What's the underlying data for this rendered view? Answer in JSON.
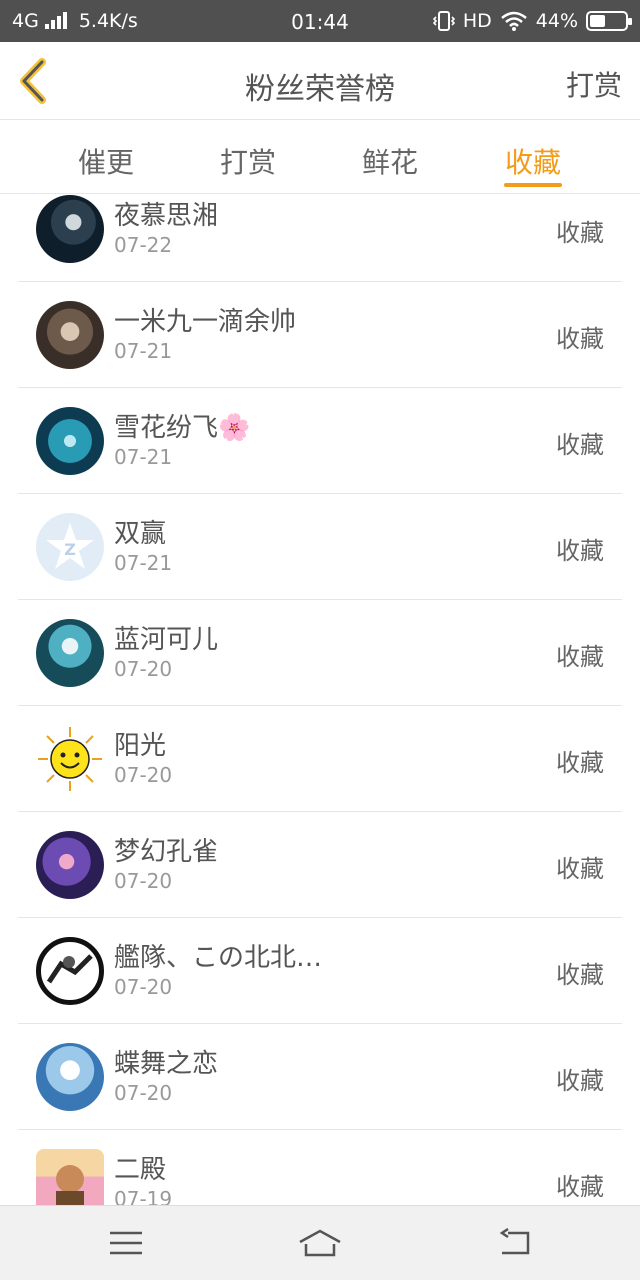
{
  "status_bar": {
    "network": "4G",
    "speed": "5.4K/s",
    "time": "01:44",
    "hd": "HD",
    "battery": "44%",
    "battery_level": 0.44
  },
  "header": {
    "back_icon": "chevron-left-icon",
    "title": "粉丝荣誉榜",
    "right_action": "打赏"
  },
  "tabs": [
    {
      "label": "催更"
    },
    {
      "label": "打赏"
    },
    {
      "label": "鲜花"
    },
    {
      "label": "收藏"
    }
  ],
  "active_tab": "收藏",
  "colors": {
    "accent": "#f39c19",
    "status_bar": "#505050",
    "text": "#555555",
    "subtext": "#999999",
    "divider": "#e6e6e6"
  },
  "list": [
    {
      "name": "夜慕思湘",
      "date": "07-22",
      "action": "收藏"
    },
    {
      "name": "一米九一滴余帅",
      "date": "07-21",
      "action": "收藏"
    },
    {
      "name": "雪花纷飞🌸",
      "date": "07-21",
      "action": "收藏"
    },
    {
      "name": "双赢",
      "date": "07-21",
      "action": "收藏"
    },
    {
      "name": "蓝河可儿",
      "date": "07-20",
      "action": "收藏"
    },
    {
      "name": "阳光",
      "date": "07-20",
      "action": "收藏"
    },
    {
      "name": "梦幻孔雀",
      "date": "07-20",
      "action": "收藏"
    },
    {
      "name": "艦隊、この北北…",
      "date": "07-20",
      "action": "收藏"
    },
    {
      "name": "蝶舞之恋",
      "date": "07-20",
      "action": "收藏"
    },
    {
      "name": "二殿",
      "date": "07-19",
      "action": "收藏"
    }
  ],
  "nav_bar": {
    "menu_icon": "menu-icon",
    "home_icon": "home-icon",
    "back_icon": "back-icon"
  }
}
